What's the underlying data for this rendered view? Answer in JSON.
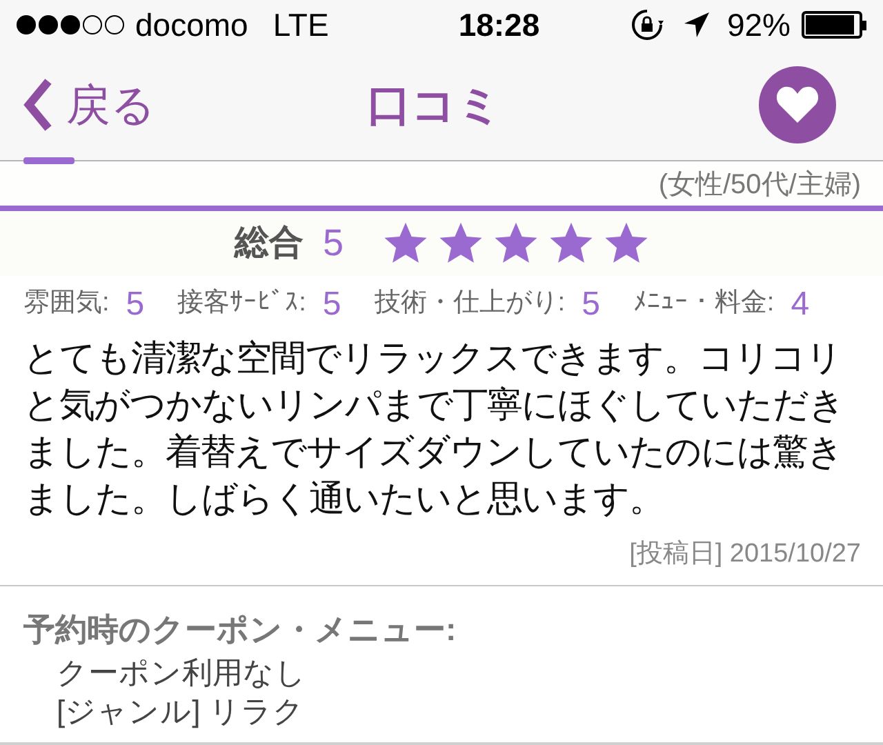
{
  "status_bar": {
    "signal_dots": [
      {
        "filled": true
      },
      {
        "filled": true
      },
      {
        "filled": true
      },
      {
        "filled": false
      },
      {
        "filled": false
      }
    ],
    "carrier": "docomo",
    "network": "LTE",
    "time": "18:28",
    "battery_percent": "92%"
  },
  "nav_bar": {
    "back_label": "戻る",
    "title": "口コミ"
  },
  "reviewer": "(女性/50代/主婦)",
  "overall": {
    "label": "総合",
    "score": "5",
    "stars": 5
  },
  "sub_ratings": [
    {
      "label": "雰囲気:",
      "value": "5"
    },
    {
      "label": "接客ｻｰﾋﾞｽ:",
      "value": "5"
    },
    {
      "label": "技術・仕上がり:",
      "value": "5"
    },
    {
      "label": "ﾒﾆｭｰ・料金:",
      "value": "4"
    }
  ],
  "body": "とても清潔な空間でリラックスできます。コリコリと気がつかないリンパまで丁寧にほぐしていただきました。着替えでサイズダウンしていたのには驚きました。しばらく通いたいと思います。",
  "posted": "[投稿日] 2015/10/27",
  "coupon": {
    "heading": "予約時のクーポン・メニュー:",
    "lines": [
      "クーポン利用なし",
      "[ジャンル] リラク"
    ]
  }
}
